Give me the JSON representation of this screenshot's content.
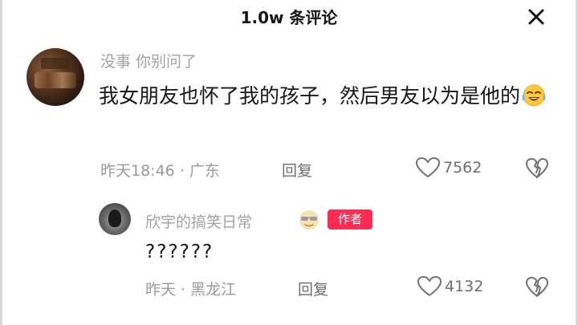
{
  "header": {
    "title": "1.0w 条评论",
    "close_icon": "close-icon"
  },
  "comment": {
    "username": "没事 你别问了",
    "text": "我女朋友也怀了我的孩子，然后男友以为是他的",
    "emoji": "laugh-cry-emoji",
    "time": "昨天18:46",
    "location": "广东",
    "reply_label": "回复",
    "like_count": "7562"
  },
  "reply": {
    "username": "欣宇的搞笑日常",
    "emoji": "sunglasses-emoji",
    "badge": "作者",
    "text": "??????",
    "time": "昨天",
    "location": "黑龙江",
    "reply_label": "回复",
    "like_count": "4132"
  },
  "colors": {
    "badge_bg": "#fe2c55",
    "username": "#a2a2a2",
    "meta": "#9a9a9a"
  }
}
